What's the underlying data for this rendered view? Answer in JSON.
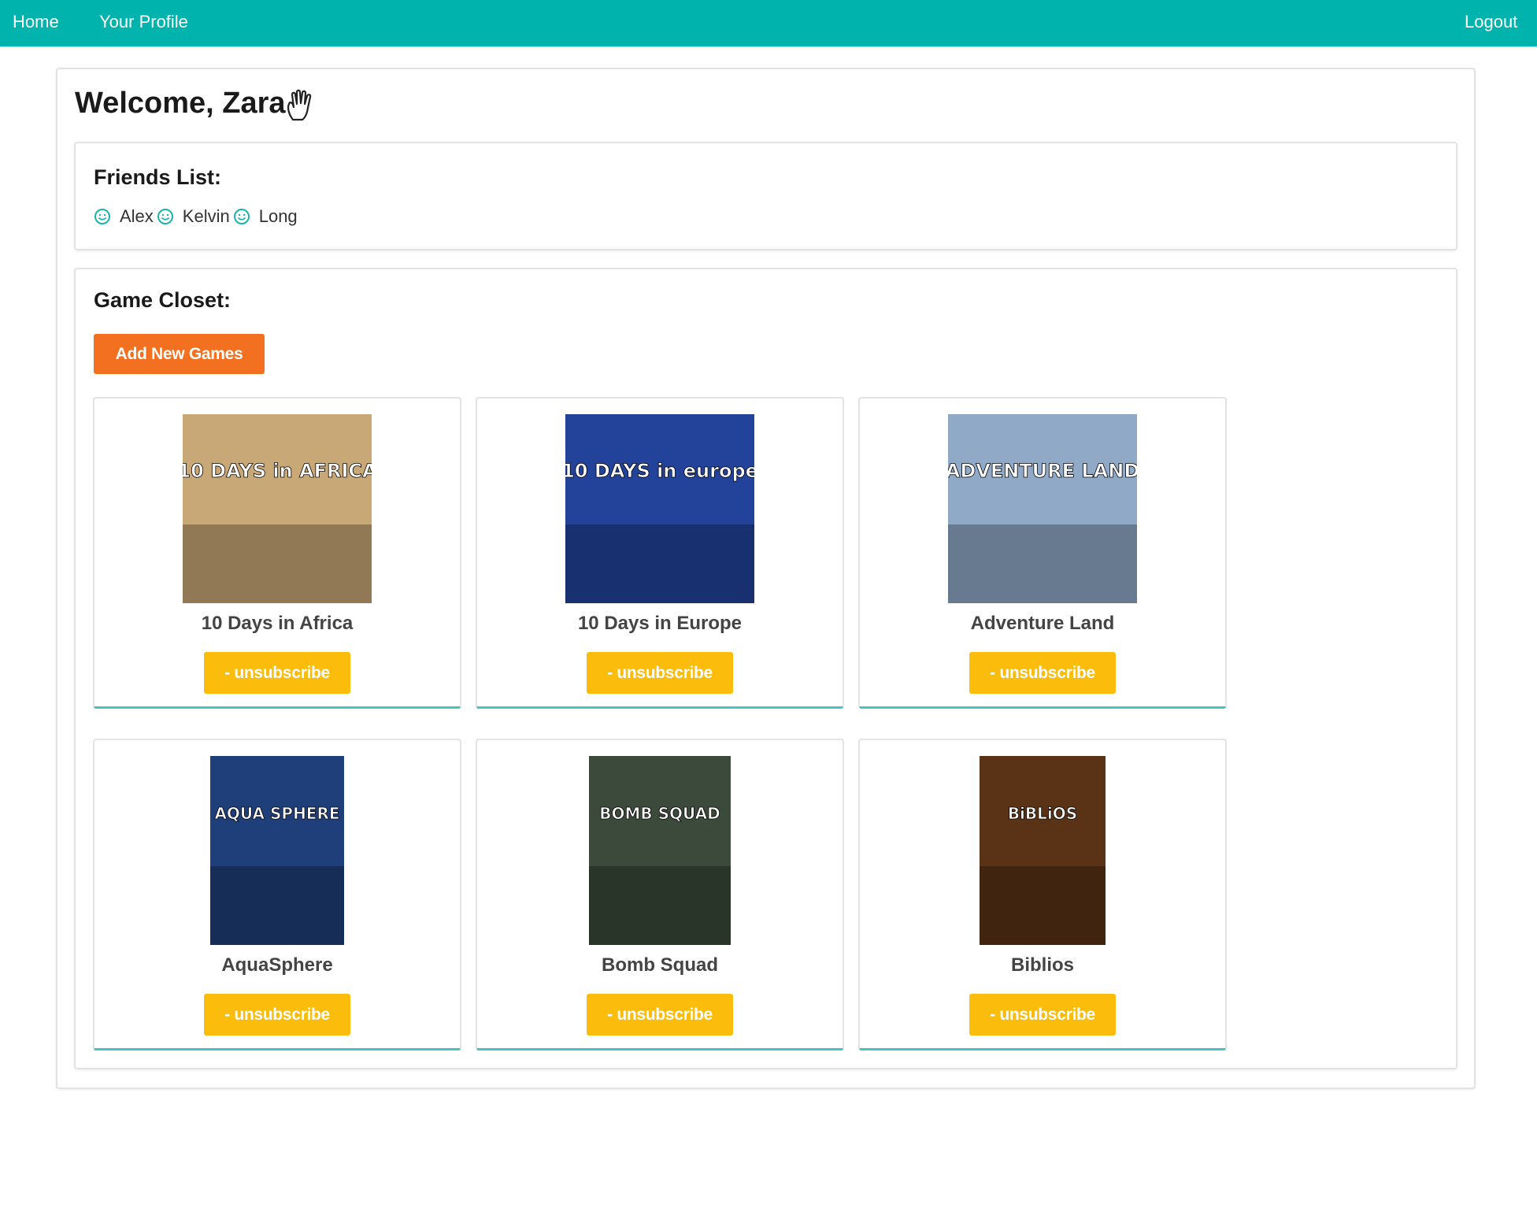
{
  "nav": {
    "home": "Home",
    "profile": "Your Profile",
    "logout": "Logout"
  },
  "welcome": "Welcome, Zara",
  "friends": {
    "title": "Friends List:",
    "names": [
      "Alex",
      "Kelvin",
      "Long"
    ]
  },
  "closet": {
    "title": "Game Closet:",
    "add_button": "Add New Games",
    "unsubscribe_label": "- unsubscribe",
    "games": [
      {
        "title": "10 Days in Africa",
        "cover_text": "10 DAYS in AFRICA",
        "cover_color": "#c9a877"
      },
      {
        "title": "10 Days in Europe",
        "cover_text": "10 DAYS in europe",
        "cover_color": "#23439b"
      },
      {
        "title": "Adventure Land",
        "cover_text": "ADVENTURE LAND",
        "cover_color": "#8fa9c7"
      },
      {
        "title": "AquaSphere",
        "cover_text": "AQUA SPHERE",
        "cover_color": "#1f3f7a"
      },
      {
        "title": "Bomb Squad",
        "cover_text": "BOMB SQUAD",
        "cover_color": "#3b4a3a"
      },
      {
        "title": "Biblios",
        "cover_text": "BiBLiOS",
        "cover_color": "#5a3216"
      }
    ]
  },
  "colors": {
    "navbar": "#00b3ac",
    "add_button": "#f37021",
    "unsubscribe_button": "#fcbc0c",
    "smile_icon": "#1bb3ad"
  },
  "icons": {
    "wave": "raised-hand-icon",
    "friend": "smile-icon"
  }
}
